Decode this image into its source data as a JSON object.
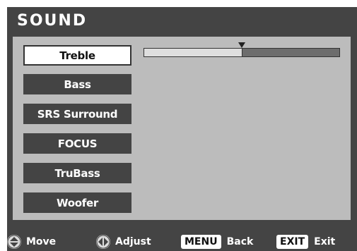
{
  "header": {
    "title": "SOUND"
  },
  "menu": {
    "items": [
      {
        "label": "Treble",
        "selected": true
      },
      {
        "label": "Bass",
        "selected": false
      },
      {
        "label": "SRS Surround",
        "selected": false
      },
      {
        "label": "FOCUS",
        "selected": false
      },
      {
        "label": "TruBass",
        "selected": false
      },
      {
        "label": "Woofer",
        "selected": false
      }
    ]
  },
  "treble_slider": {
    "level": 0.5
  },
  "footer": {
    "move_icon": "up-down-arrows-icon",
    "move_label": "Move",
    "adjust_icon": "left-right-arrows-icon",
    "adjust_label": "Adjust",
    "menu_key": "MENU",
    "back_label": "Back",
    "exit_key": "EXIT",
    "exit_label": "Exit"
  },
  "colors": {
    "frame": "#444444",
    "panel": "#bcbcbc",
    "slider_filled": "#dedede",
    "slider_empty": "#6d6d6d"
  }
}
